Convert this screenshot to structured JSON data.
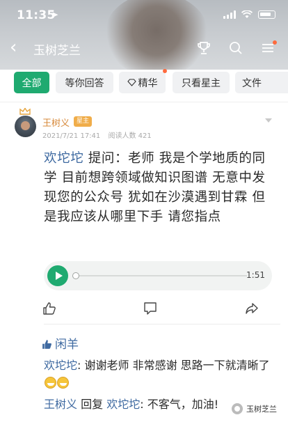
{
  "status_bar": {
    "time": "11:35"
  },
  "nav": {
    "title": "玉树芝兰"
  },
  "tabs": [
    {
      "label": "全部",
      "active": true
    },
    {
      "label": "等你回答",
      "active": false
    },
    {
      "label": "精华",
      "active": false,
      "has_dot": true
    },
    {
      "label": "只看星主",
      "active": false
    },
    {
      "label": "文件",
      "active": false
    }
  ],
  "post": {
    "author": "王树义",
    "badge": "星主",
    "date": "2021/7/21 17:41",
    "reads": "阅读人数 421",
    "question": {
      "asker": "欢坨坨",
      "prefix": " 提问：",
      "text": "老师 我是个学地质的同学 目前想跨领域做知识图谱 无意中发现您的公众号 犹如在沙漠遇到甘霖 但是我应该从哪里下手 请您指点"
    },
    "audio": {
      "duration": "1:51",
      "progress": 0
    }
  },
  "likes": {
    "user": "闲羊"
  },
  "comments": [
    {
      "user": "欢坨坨",
      "text": ": 谢谢老师 非常感谢 思路一下就清晰了"
    },
    {
      "user": "王树义",
      "reply_word": " 回复 ",
      "target": "欢坨坨",
      "text": ": 不客气，加油!"
    }
  ],
  "watermark": {
    "text": "玉树芝兰"
  },
  "colors": {
    "accent": "#1faa70",
    "author": "#d7893a",
    "link": "#3f6aa1",
    "badge": "#f0ad4a"
  }
}
